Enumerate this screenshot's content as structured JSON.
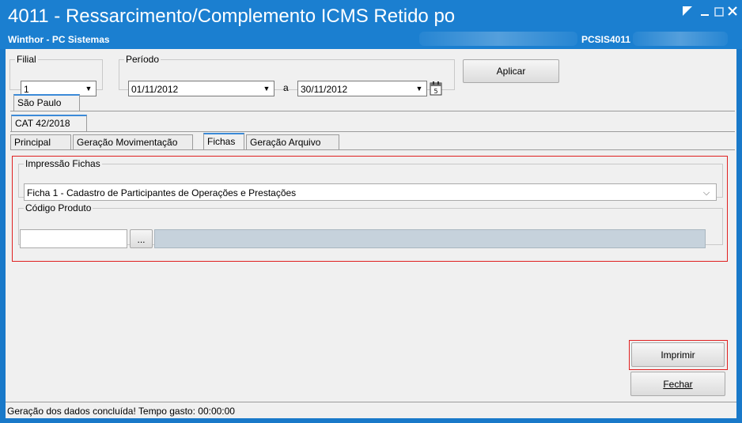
{
  "window": {
    "title": "4011 - Ressarcimento/Complemento ICMS Retido po",
    "subtitle": "Winthor - PC Sistemas",
    "system_id": "PCSIS4011"
  },
  "filters": {
    "filial_label": "Filial",
    "filial_value": "1",
    "periodo_label": "Período",
    "date_from": "01/11/2012",
    "separator": "a",
    "date_to": "30/11/2012",
    "apply_label": "Aplicar"
  },
  "tabs": {
    "state": "São Paulo",
    "cat": "CAT 42/2018",
    "items": [
      "Principal",
      "Geração Movimentação",
      "Fichas",
      "Geração Arquivo"
    ],
    "active": "Fichas"
  },
  "fichas": {
    "group_label": "Impressão Fichas",
    "selected": "Ficha 1 - Cadastro de Participantes de Operações e Prestações",
    "product_label": "Código Produto",
    "product_code": "",
    "lookup_label": "...",
    "product_description": ""
  },
  "actions": {
    "print_label": "Imprimir",
    "close_label": "Fechar"
  },
  "status": {
    "text": "Geração dos dados concluída! Tempo gasto: 00:00:00"
  },
  "colors": {
    "titlebar": "#1b7fd0",
    "highlight": "#e02020"
  }
}
